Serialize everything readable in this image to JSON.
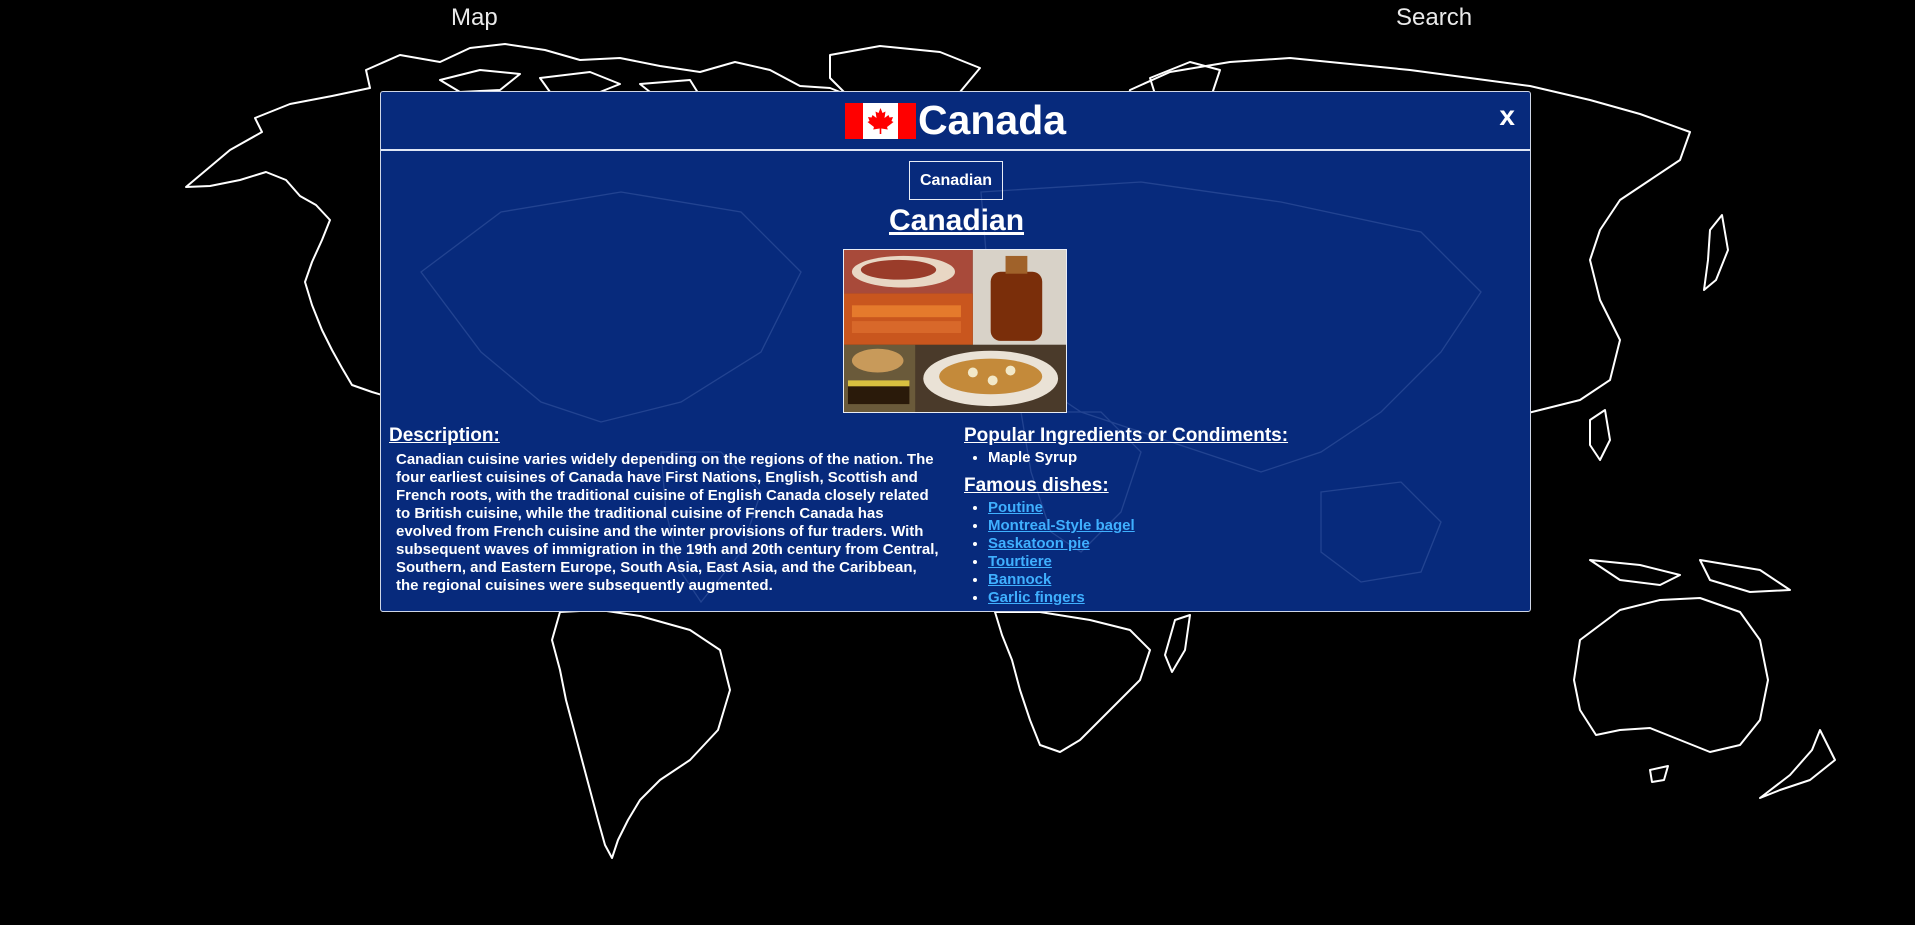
{
  "nav": {
    "map_label": "Map",
    "search_label": "Search"
  },
  "modal": {
    "country": "Canada",
    "close_label": "x",
    "tab_label": "Canadian",
    "cuisine_title": "Canadian",
    "description_heading": "Description:",
    "description": "Canadian cuisine varies widely depending on the regions of the nation. The four earliest cuisines of Canada have First Nations, English, Scottish and French roots, with the traditional cuisine of English Canada closely related to British cuisine, while the traditional cuisine of French Canada has evolved from French cuisine and the winter provisions of fur traders. With subsequent waves of immigration in the 19th and 20th century from Central, Southern, and Eastern Europe, South Asia, East Asia, and the Caribbean, the regional cuisines were subsequently augmented.",
    "ingredients_heading": "Popular Ingredients or Condiments:",
    "ingredients": [
      "Maple Syrup"
    ],
    "dishes_heading": "Famous dishes:",
    "dishes": [
      "Poutine",
      "Montreal-Style bagel",
      "Saskatoon pie",
      "Tourtiere",
      "Bannock",
      "Garlic fingers"
    ]
  },
  "colors": {
    "page_background": "#000000",
    "modal_background": "#072a7c",
    "link": "#3fb0ff",
    "flag_red": "#ff0000"
  }
}
